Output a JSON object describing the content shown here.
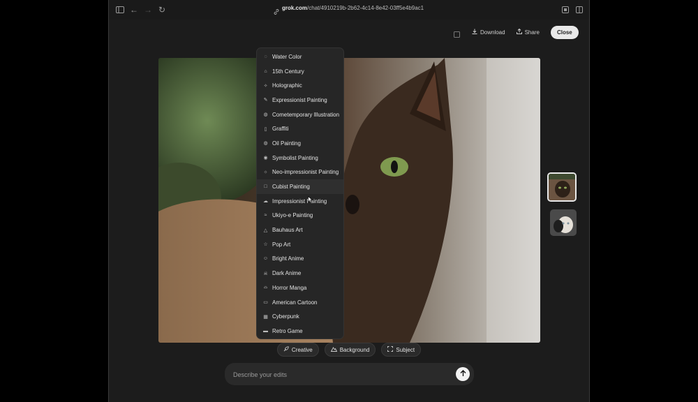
{
  "browser": {
    "url_host": "grok.com",
    "url_path": "/chat/4910219b-2b62-4c14-8e42-03ff5e4b9ac1"
  },
  "toolbar": {
    "download_label": "Download",
    "share_label": "Share",
    "close_label": "Close"
  },
  "style_menu": {
    "items": [
      {
        "label": "Water Color",
        "icon": "drop-icon"
      },
      {
        "label": "15th Century",
        "icon": "castle-icon"
      },
      {
        "label": "Holographic",
        "icon": "sparkle-icon"
      },
      {
        "label": "Expressionist Painting",
        "icon": "brush-icon"
      },
      {
        "label": "Cometemporary Illustration",
        "icon": "palette-icon"
      },
      {
        "label": "Graffiti",
        "icon": "spray-can-icon"
      },
      {
        "label": "Oil Painting",
        "icon": "palette-icon"
      },
      {
        "label": "Symbolist Painting",
        "icon": "eye-icon"
      },
      {
        "label": "Neo-impressionist Painting",
        "icon": "sun-icon"
      },
      {
        "label": "Cubist Painting",
        "icon": "square-icon"
      },
      {
        "label": "Impressionist Painting",
        "icon": "cloud-icon"
      },
      {
        "label": "Ukiyo-e Painting",
        "icon": "wave-icon"
      },
      {
        "label": "Bauhaus Art",
        "icon": "shapes-icon"
      },
      {
        "label": "Pop Art",
        "icon": "star-icon"
      },
      {
        "label": "Bright Anime",
        "icon": "smile-icon"
      },
      {
        "label": "Dark Anime",
        "icon": "skull-icon"
      },
      {
        "label": "Horror Manga",
        "icon": "ghost-icon"
      },
      {
        "label": "American Cartoon",
        "icon": "tv-icon"
      },
      {
        "label": "Cyberpunk",
        "icon": "chip-icon"
      },
      {
        "label": "Retro Game",
        "icon": "gamepad-icon"
      }
    ]
  },
  "edit_chips": {
    "creative_label": "Creative",
    "background_label": "Background",
    "subject_label": "Subject"
  },
  "edit_input": {
    "placeholder": "Describe your edits",
    "value": ""
  },
  "colors": {
    "accent": "#e9e9e9",
    "panel": "#262626",
    "background": "#1c1c1c"
  }
}
